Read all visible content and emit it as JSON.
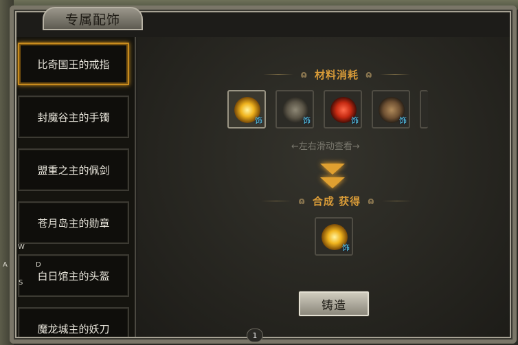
{
  "window": {
    "title": "专属配饰"
  },
  "list": {
    "items": [
      {
        "label": "比奇国王的戒指",
        "selected": true
      },
      {
        "label": "封魔谷主的手镯",
        "selected": false
      },
      {
        "label": "盟重之主的佩剑",
        "selected": false
      },
      {
        "label": "苍月岛主的勋章",
        "selected": false
      },
      {
        "label": "白日馆主的头盔",
        "selected": false
      },
      {
        "label": "魔龙城主的妖刀",
        "selected": false
      }
    ]
  },
  "materials": {
    "heading": "材料消耗",
    "slots": [
      {
        "icon": "gold-ring-icon",
        "tag": "饰"
      },
      {
        "icon": "grey-beast-icon",
        "tag": "饰"
      },
      {
        "icon": "red-demon-icon",
        "tag": "饰"
      },
      {
        "icon": "brown-creature-icon",
        "tag": "饰"
      }
    ],
    "scroll_hint": "←左右滑动查看→"
  },
  "result": {
    "heading": "合成 获得",
    "slot": {
      "icon": "gold-ring-icon",
      "tag": "饰"
    }
  },
  "actions": {
    "forge_label": "铸造"
  },
  "overlay": {
    "page_badge": "1",
    "minimap_letters": [
      "W",
      "A",
      "D",
      "S"
    ]
  },
  "colors": {
    "accent_gold": "#d89b38",
    "selection_border": "#c98c1e",
    "tag_cyan": "#5ee0ff"
  }
}
